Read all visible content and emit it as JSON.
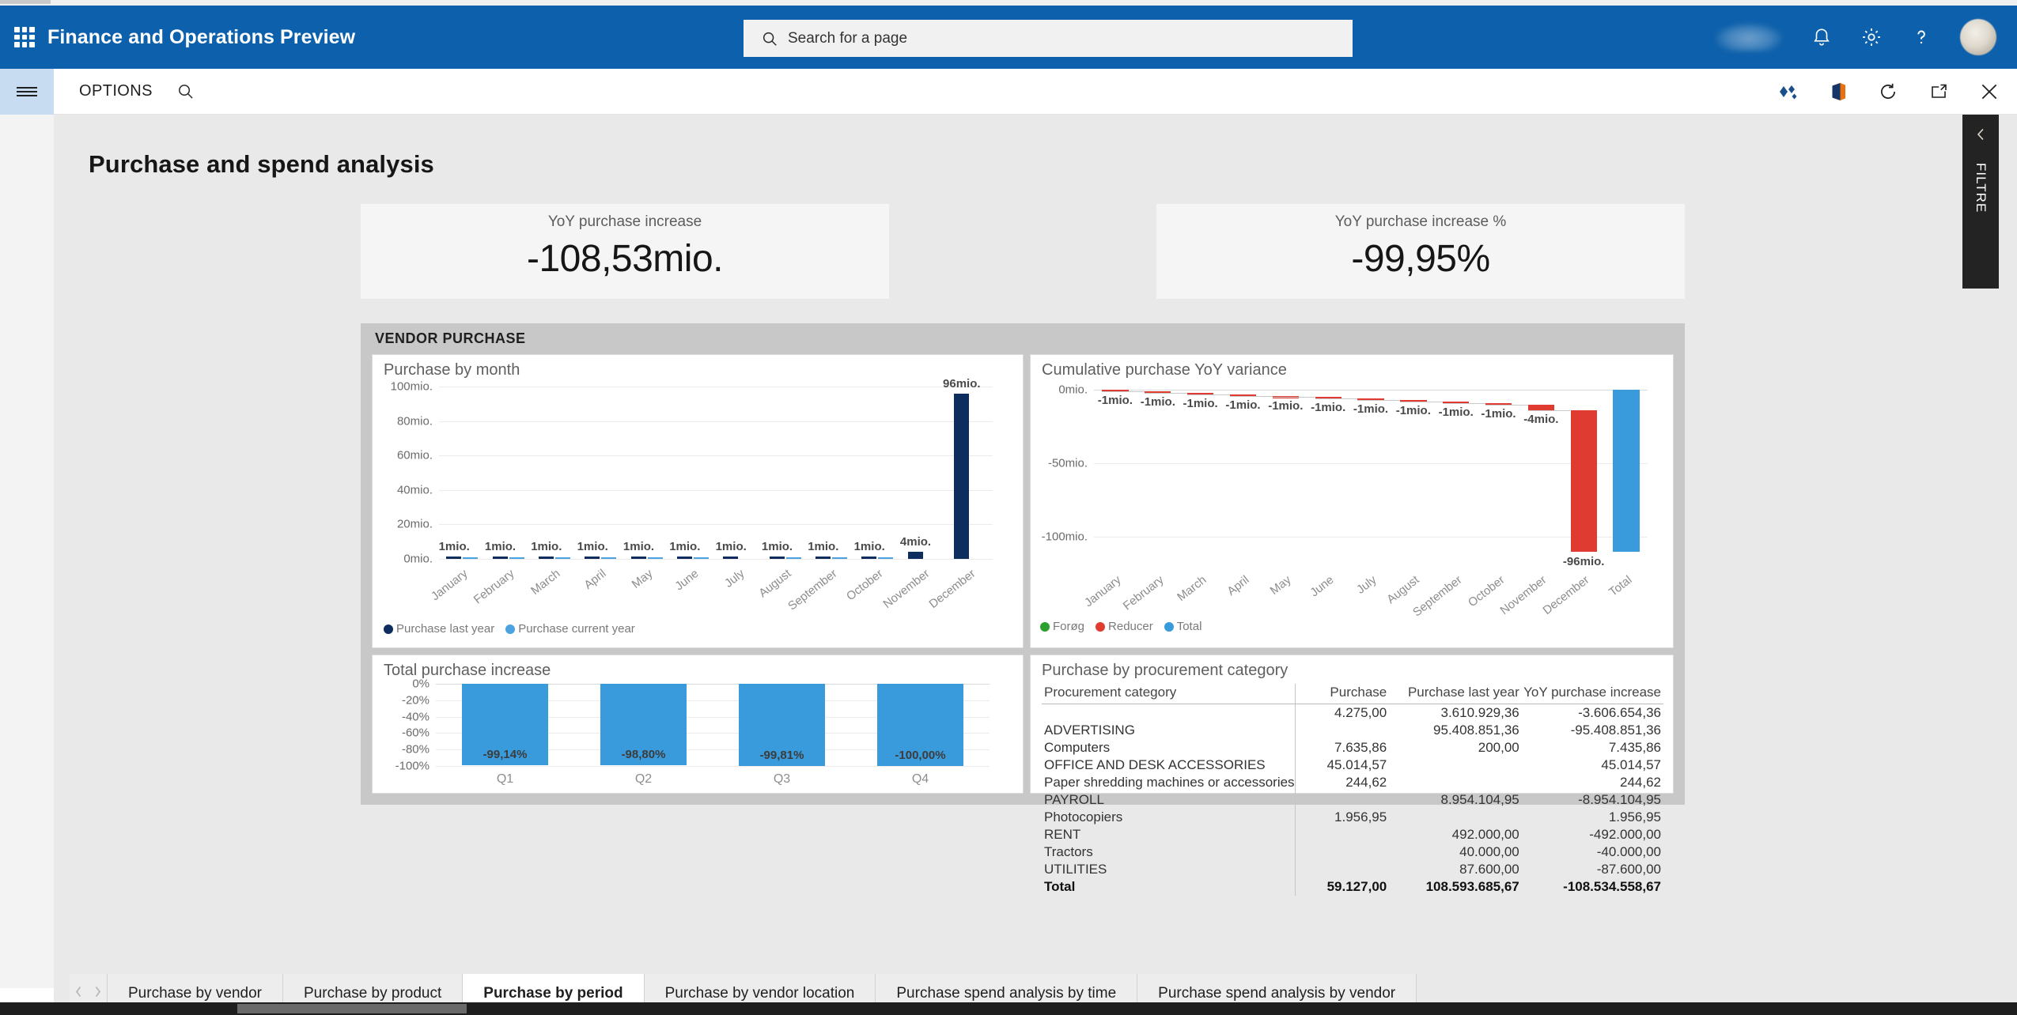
{
  "topbar": {
    "app_title": "Finance and Operations Preview",
    "waffle_icon": "app-launcher-icon",
    "search_placeholder": "Search for a page",
    "search_icon": "search-icon",
    "icons": [
      "cloud-icon",
      "notifications-bell-icon",
      "settings-gear-icon",
      "help-question-icon",
      "user-avatar"
    ],
    "brand_color": "#0d60ab"
  },
  "commandbar": {
    "menu_icon": "hamburger-menu-icon",
    "options_label": "OPTIONS",
    "search_icon": "search-icon",
    "icons": [
      "dynamics-diamond-icon",
      "open-in-office-icon",
      "refresh-icon",
      "open-in-new-window-icon",
      "close-icon"
    ]
  },
  "page": {
    "title": "Purchase and spend analysis"
  },
  "kpis": [
    {
      "label": "YoY purchase increase",
      "value": "-108,53mio."
    },
    {
      "label": "YoY purchase increase %",
      "value": "-99,95%"
    }
  ],
  "panel": {
    "header": "VENDOR PURCHASE"
  },
  "filter_panel": {
    "label": "FILTRE",
    "collapse_icon": "chevron-left-icon"
  },
  "tabs": {
    "prev_icon": "chevron-left-icon",
    "next_icon": "chevron-right-icon",
    "items": [
      {
        "label": "Purchase by vendor",
        "active": false
      },
      {
        "label": "Purchase by product",
        "active": false
      },
      {
        "label": "Purchase by period",
        "active": true
      },
      {
        "label": "Purchase by vendor location",
        "active": false
      },
      {
        "label": "Purchase spend analysis by time",
        "active": false
      },
      {
        "label": "Purchase spend analysis by vendor",
        "active": false
      }
    ],
    "active_underline_color": "#ffb900"
  },
  "chart_data": [
    {
      "id": "purchase-by-month",
      "type": "bar",
      "title": "Purchase by month",
      "xlabel": "",
      "ylabel": "",
      "ylim": [
        0,
        100
      ],
      "ytick_labels": [
        "0mio.",
        "20mio.",
        "40mio.",
        "60mio.",
        "80mio.",
        "100mio."
      ],
      "ytick_values": [
        0,
        20,
        40,
        60,
        80,
        100
      ],
      "grid": true,
      "legend_position": "bottom-left",
      "categories": [
        "January",
        "February",
        "March",
        "April",
        "May",
        "June",
        "July",
        "August",
        "September",
        "October",
        "November",
        "December"
      ],
      "series": [
        {
          "name": "Purchase last year",
          "color": "#0d2d5e",
          "values": [
            1,
            1,
            1,
            1,
            1,
            1,
            1,
            1,
            1,
            1,
            4,
            96
          ],
          "labels": [
            "1mio.",
            "1mio.",
            "1mio.",
            "1mio.",
            "1mio.",
            "1mio.",
            "1mio.",
            "1mio.",
            "1mio.",
            "1mio.",
            "4mio.",
            "96mio."
          ]
        },
        {
          "name": "Purchase current year",
          "color": "#4aa3e0",
          "values": [
            0.1,
            0.1,
            0.1,
            0.1,
            0.1,
            0.1,
            0,
            0.1,
            0.1,
            0.1,
            0,
            0
          ],
          "labels": [
            "",
            "",
            "",
            "",
            "",
            "",
            "",
            "",
            "",
            "",
            "",
            ""
          ]
        }
      ]
    },
    {
      "id": "cumulative-purchase-yoy-variance",
      "type": "waterfall",
      "title": "Cumulative purchase YoY variance",
      "xlabel": "",
      "ylabel": "",
      "ylim": [
        -110,
        0
      ],
      "ytick_labels": [
        "0mio.",
        "-50mio.",
        "-100mio."
      ],
      "ytick_values": [
        0,
        -50,
        -100
      ],
      "grid": true,
      "legend_position": "bottom-left",
      "legend": [
        {
          "name": "Forøg",
          "color": "#2ca02c"
        },
        {
          "name": "Reducer",
          "color": "#e03b30"
        },
        {
          "name": "Total",
          "color": "#3a9bdc"
        }
      ],
      "categories": [
        "January",
        "February",
        "March",
        "April",
        "May",
        "June",
        "July",
        "August",
        "September",
        "October",
        "November",
        "December",
        "Total"
      ],
      "deltas": [
        -1,
        -1,
        -1,
        -1,
        -1,
        -1,
        -1,
        -1,
        -1,
        -1,
        -4,
        -96,
        null
      ],
      "labels": [
        "-1mio.",
        "-1mio.",
        "-1mio.",
        "-1mio.",
        "-1mio.",
        "-1mio.",
        "-1mio.",
        "-1mio.",
        "-1mio.",
        "-1mio.",
        "-4mio.",
        "-96mio.",
        ""
      ],
      "total_value": -108.53,
      "cumulative": [
        -1,
        -2,
        -3,
        -4,
        -5,
        -6,
        -7,
        -8,
        -9,
        -10,
        -14,
        -110
      ]
    },
    {
      "id": "total-purchase-increase",
      "type": "bar",
      "title": "Total purchase increase",
      "xlabel": "",
      "ylabel": "",
      "ylim": [
        -100,
        0
      ],
      "ytick_labels": [
        "0%",
        "-20%",
        "-40%",
        "-60%",
        "-80%",
        "-100%"
      ],
      "ytick_values": [
        0,
        -20,
        -40,
        -60,
        -80,
        -100
      ],
      "grid": true,
      "bar_color": "#3a9bdc",
      "categories": [
        "Q1",
        "Q2",
        "Q3",
        "Q4"
      ],
      "values": [
        -99.14,
        -98.8,
        -99.81,
        -100.0
      ],
      "labels": [
        "-99,14%",
        "-98,80%",
        "-99,81%",
        "-100,00%"
      ]
    },
    {
      "id": "purchase-by-procurement-category",
      "type": "table",
      "title": "Purchase by procurement category",
      "columns": [
        "Procurement category",
        "Purchase",
        "Purchase last year",
        "YoY purchase increase"
      ],
      "rows": [
        {
          "category": "",
          "purchase": "4.275,00",
          "last_year": "3.610.929,36",
          "yoy": "-3.606.654,36"
        },
        {
          "category": "ADVERTISING",
          "purchase": "",
          "last_year": "95.408.851,36",
          "yoy": "-95.408.851,36"
        },
        {
          "category": "Computers",
          "purchase": "7.635,86",
          "last_year": "200,00",
          "yoy": "7.435,86"
        },
        {
          "category": "OFFICE AND DESK ACCESSORIES",
          "purchase": "45.014,57",
          "last_year": "",
          "yoy": "45.014,57"
        },
        {
          "category": "Paper shredding machines or accessories",
          "purchase": "244,62",
          "last_year": "",
          "yoy": "244,62"
        },
        {
          "category": "PAYROLL",
          "purchase": "",
          "last_year": "8.954.104,95",
          "yoy": "-8.954.104,95"
        },
        {
          "category": "Photocopiers",
          "purchase": "1.956,95",
          "last_year": "",
          "yoy": "1.956,95"
        },
        {
          "category": "RENT",
          "purchase": "",
          "last_year": "492.000,00",
          "yoy": "-492.000,00"
        },
        {
          "category": "Tractors",
          "purchase": "",
          "last_year": "40.000,00",
          "yoy": "-40.000,00"
        },
        {
          "category": "UTILITIES",
          "purchase": "",
          "last_year": "87.600,00",
          "yoy": "-87.600,00"
        }
      ],
      "total_row": {
        "category": "Total",
        "purchase": "59.127,00",
        "last_year": "108.593.685,67",
        "yoy": "-108.534.558,67"
      }
    }
  ]
}
